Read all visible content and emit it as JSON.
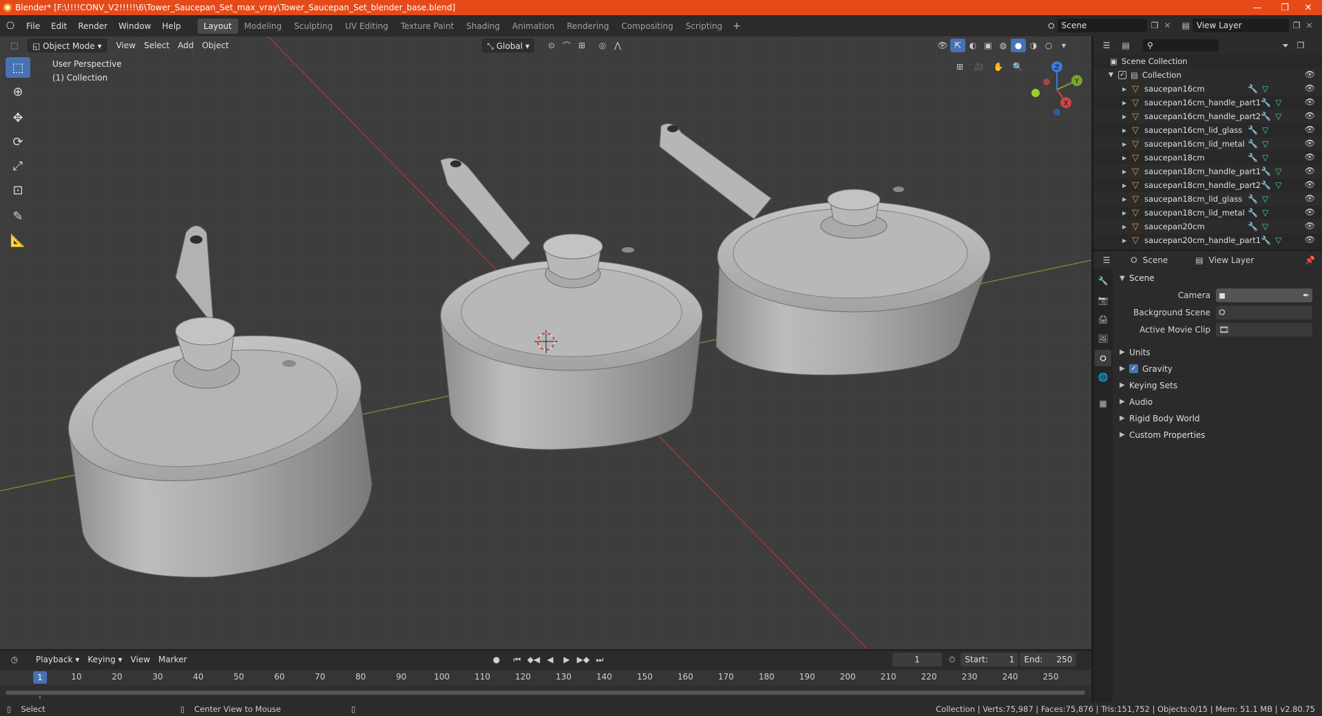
{
  "window": {
    "title": "Blender* [F:\\!!!!CONV_V2!!!!!\\6\\Tower_Saucepan_Set_max_vray\\Tower_Saucepan_Set_blender_base.blend]",
    "minimize": "—",
    "maximize": "❐",
    "close": "✕"
  },
  "menu": [
    "File",
    "Edit",
    "Render",
    "Window",
    "Help"
  ],
  "workspaces": [
    "Layout",
    "Modeling",
    "Sculpting",
    "UV Editing",
    "Texture Paint",
    "Shading",
    "Animation",
    "Rendering",
    "Compositing",
    "Scripting"
  ],
  "active_workspace": "Layout",
  "scene_field": "Scene",
  "viewlayer_field": "View Layer",
  "viewport_header": {
    "mode": "Object Mode",
    "menus": [
      "View",
      "Select",
      "Add",
      "Object"
    ],
    "transform_orientation": "Global"
  },
  "viewport_info": {
    "line1": "User Perspective",
    "line2": "(1) Collection"
  },
  "gizmo": {
    "x": "X",
    "y": "Y",
    "z": "Z"
  },
  "outliner": {
    "search_placeholder": "",
    "root": "Scene Collection",
    "collection": "Collection",
    "objects": [
      {
        "name": "saucepan16cm",
        "mod": true
      },
      {
        "name": "saucepan16cm_handle_part1",
        "mod": true
      },
      {
        "name": "saucepan16cm_handle_part2",
        "mod": true
      },
      {
        "name": "saucepan16cm_lid_glass",
        "mod": true
      },
      {
        "name": "saucepan16cm_lid_metal",
        "mod": true
      },
      {
        "name": "saucepan18cm",
        "mod": true
      },
      {
        "name": "saucepan18cm_handle_part1",
        "mod": true
      },
      {
        "name": "saucepan18cm_handle_part2",
        "mod": true
      },
      {
        "name": "saucepan18cm_lid_glass",
        "mod": true
      },
      {
        "name": "saucepan18cm_lid_metal",
        "mod": true
      },
      {
        "name": "saucepan20cm",
        "mod": true
      },
      {
        "name": "saucepan20cm_handle_part1",
        "mod": true
      }
    ]
  },
  "properties": {
    "header_scene": "Scene",
    "header_viewlayer": "View Layer",
    "panel_title": "Scene",
    "rows": [
      {
        "label": "Camera",
        "value": ""
      },
      {
        "label": "Background Scene",
        "value": ""
      },
      {
        "label": "Active Movie Clip",
        "value": ""
      }
    ],
    "sub_panels": [
      "Units",
      "Gravity",
      "Keying Sets",
      "Audio",
      "Rigid Body World",
      "Custom Properties"
    ],
    "gravity_checked": true
  },
  "timeline": {
    "menus": [
      "Playback",
      "Keying",
      "View",
      "Marker"
    ],
    "current_frame": "1",
    "start_label": "Start:",
    "start": "1",
    "end_label": "End:",
    "end": "250",
    "ticks": [
      "1",
      "10",
      "20",
      "30",
      "40",
      "50",
      "60",
      "70",
      "80",
      "90",
      "100",
      "110",
      "120",
      "130",
      "140",
      "150",
      "160",
      "170",
      "180",
      "190",
      "200",
      "210",
      "220",
      "230",
      "240",
      "250"
    ]
  },
  "status": {
    "left": "Select",
    "middle": "Center View to Mouse",
    "right": "Collection | Verts:75,987 | Faces:75,876 | Tris:151,752 | Objects:0/15 | Mem: 51.1 MB | v2.80.75"
  }
}
